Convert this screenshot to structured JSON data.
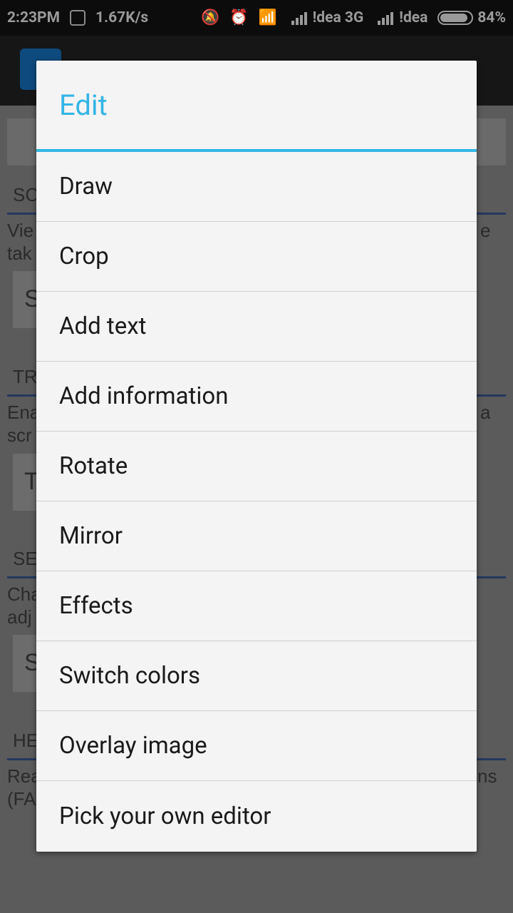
{
  "status_bar": {
    "time": "2:23PM",
    "speed": "1.67K/s",
    "carrier1": "!dea 3G",
    "carrier2": "!dea",
    "battery": "84%"
  },
  "dialog": {
    "title": "Edit",
    "items": [
      {
        "label": "Draw"
      },
      {
        "label": "Crop"
      },
      {
        "label": "Add text"
      },
      {
        "label": "Add information"
      },
      {
        "label": "Rotate"
      },
      {
        "label": "Mirror"
      },
      {
        "label": "Effects"
      },
      {
        "label": "Switch colors"
      },
      {
        "label": "Overlay image"
      },
      {
        "label": "Pick your own editor"
      }
    ]
  },
  "background": {
    "fragments": [
      "SC",
      "Vie",
      "tak",
      "S",
      "TR",
      "Ena",
      "scr",
      "T",
      "SE",
      "Cha",
      "adj",
      "S",
      "HE",
      "Rea",
      "(FA",
      "e",
      "a",
      "ns"
    ]
  },
  "colors": {
    "accent": "#33b5e5",
    "dialog_bg": "#f4f4f4",
    "status_bar_bg": "#0c0c0c"
  }
}
